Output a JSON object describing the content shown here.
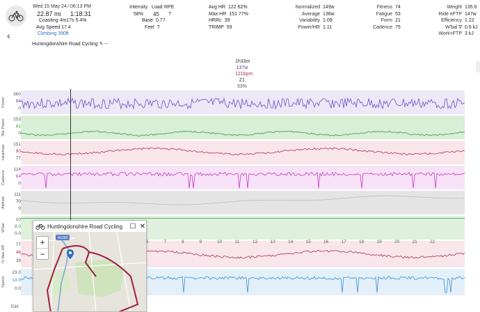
{
  "header": {
    "date": "Wed 15 May 24 ⁄ 06:13 PM",
    "distance": "22.87 mi",
    "duration": "1:18:31",
    "coasting": "Coasting 4m17s 5.4%",
    "avg_speed": "Avg Speed 17.4",
    "climbing": "Climbing 390ft",
    "route_name": "Huntingdonshire Road Cycling",
    "groups": [
      {
        "rows": [
          [
            "Intensity",
            "58%"
          ],
          [
            "Base",
            "0.77"
          ],
          [
            "Feel",
            "?"
          ]
        ],
        "extra": [
          [
            "Load",
            "45"
          ],
          [
            "RPE",
            "?"
          ]
        ]
      },
      {
        "rows": [
          [
            "Avg HR",
            "122  62%"
          ],
          [
            "Max HR",
            "151  77%"
          ],
          [
            "HRRc",
            "39"
          ],
          [
            "TRIMP",
            "59"
          ]
        ]
      },
      {
        "rows": [
          [
            "Normalized",
            "149w"
          ],
          [
            "Average",
            "136w"
          ],
          [
            "Variability",
            "1.09"
          ],
          [
            "Power/HR",
            "1.11"
          ]
        ]
      },
      {
        "rows": [
          [
            "Fitness",
            "74"
          ],
          [
            "Fatigue",
            "53"
          ],
          [
            "Form",
            "21"
          ],
          [
            "Cadence",
            "75"
          ]
        ]
      },
      {
        "rows": [
          [
            "Weight",
            "135.6"
          ],
          [
            "Ride eFTP",
            "147w"
          ],
          [
            "Efficiency",
            "1.22"
          ],
          [
            "W'bal ∇",
            "0.6 kJ"
          ],
          [
            "Work>FTP",
            "3 kJ"
          ]
        ]
      }
    ]
  },
  "cursor_stats": [
    "1h33m",
    "137w",
    "121bpm",
    "Z1",
    "53%"
  ],
  "lanes": [
    {
      "label": "Power",
      "ticks": [
        "360",
        "94",
        "0"
      ],
      "tick_colors": [
        "#555",
        "#5b3fb0",
        "#555"
      ]
    },
    {
      "label": "30s Power",
      "ticks": [
        "253",
        "81",
        "0"
      ],
      "tick_colors": [
        "#555",
        "#2a9d3c",
        "#555"
      ]
    },
    {
      "label": "Heartrate",
      "ticks": [
        "151",
        "90",
        "77"
      ],
      "tick_colors": [
        "#555",
        "#b0304a",
        "#555"
      ]
    },
    {
      "label": "Cadence",
      "ticks": [
        "114",
        "64",
        "0"
      ],
      "tick_colors": [
        "#555",
        "#c040c0",
        "#555"
      ]
    },
    {
      "label": "Altitude",
      "ticks": [
        "111",
        "70",
        "9"
      ],
      "tick_colors": [
        "#555",
        "#333",
        "#555"
      ]
    },
    {
      "label": "W'bal",
      "ticks": [
        "10",
        "8.0",
        "0.0"
      ],
      "tick_colors": [
        "#555",
        "#2a9d3c",
        "#555"
      ]
    },
    {
      "label": "% Max HR",
      "ticks": [
        "77",
        "46",
        "39"
      ],
      "tick_colors": [
        "#555",
        "#b0304a",
        "#555"
      ]
    },
    {
      "label": "Speed",
      "ticks": [
        "23.0",
        "14.9",
        "0.0"
      ],
      "tick_colors": [
        "#555",
        "#3b8fd0",
        "#555"
      ]
    }
  ],
  "xaxis": [
    "6",
    "7",
    "8",
    "9",
    "10",
    "11",
    "12",
    "13",
    "14",
    "15",
    "16",
    "17",
    "18",
    "19",
    "20",
    "21",
    "22"
  ],
  "map": {
    "title": "Huntingdonshire Road Cycling",
    "road_label": "A1260"
  },
  "edit_label": "Edit"
}
